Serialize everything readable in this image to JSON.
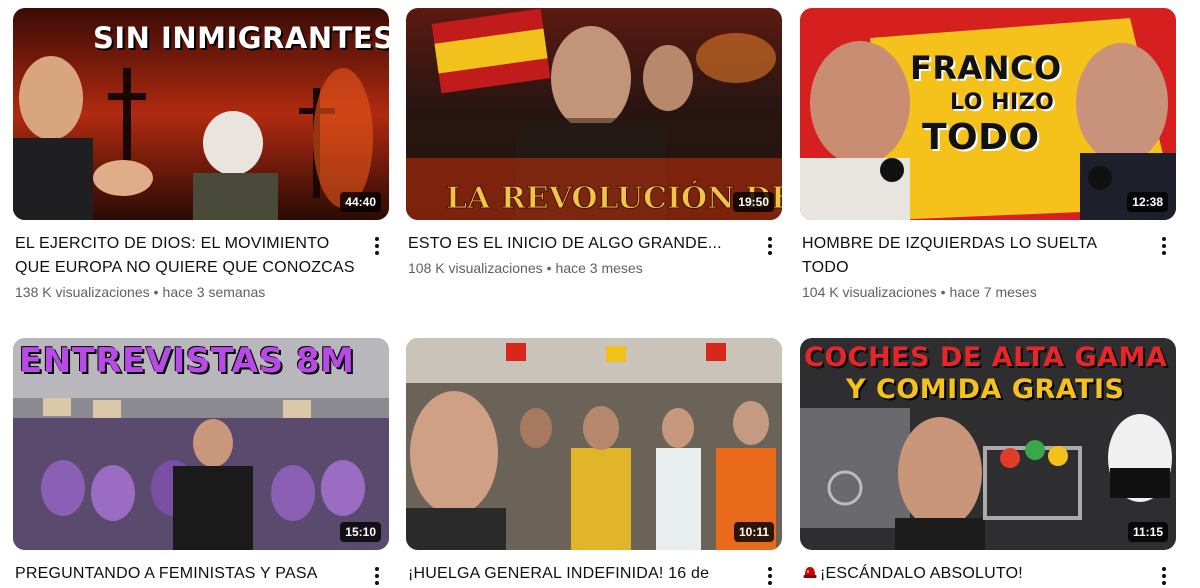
{
  "videos": [
    {
      "title": "EL EJERCITO DE DIOS: EL MOVIMIENTO QUE EUROPA NO QUIERE QUE CONOZCAS",
      "overlay": "SIN INMIGRANTES",
      "duration": "44:40",
      "views": "138 K visualizaciones",
      "age": "hace 3 semanas"
    },
    {
      "title": "ESTO ES EL INICIO DE ALGO GRANDE...",
      "overlay": "LA REVOLUCIÓN DEL PUEBLO",
      "duration": "19:50",
      "views": "108 K visualizaciones",
      "age": "hace 3 meses"
    },
    {
      "title": "HOMBRE DE IZQUIERDAS LO SUELTA TODO",
      "overlay_line1": "FRANCO",
      "overlay_line2": "LO HIZO",
      "overlay_line3": "TODO",
      "duration": "12:38",
      "views": "104 K visualizaciones",
      "age": "hace 7 meses"
    },
    {
      "title": "PREGUNTANDO A FEMINISTAS Y PASA",
      "overlay": "ENTREVISTAS 8M",
      "duration": "15:10"
    },
    {
      "title": "¡HUELGA GENERAL INDEFINIDA! 16 de",
      "duration": "10:11"
    },
    {
      "title": "¡ESCÁNDALO ABSOLUTO!",
      "overlay_line1": "COCHES DE ALTA GAMA",
      "overlay_line2": "Y COMIDA GRATIS",
      "duration": "11:15"
    }
  ],
  "colors": {
    "title_text": "#0f0f0f",
    "meta_text": "#606060",
    "alarm_icon": "#cc0000"
  }
}
